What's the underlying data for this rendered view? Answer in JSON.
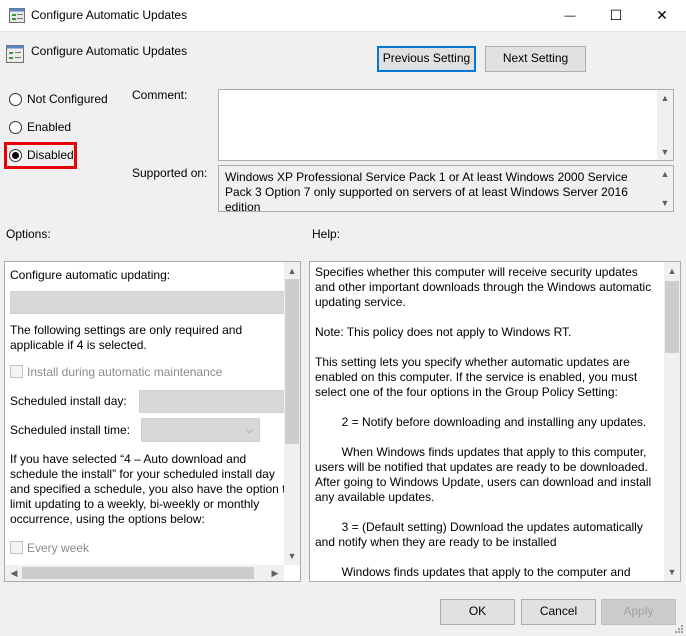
{
  "window": {
    "title": "Configure Automatic Updates",
    "minimize_glyph": "—",
    "maximize_glyph": "☐",
    "close_glyph": "✕"
  },
  "header": {
    "policy_name": "Configure Automatic Updates",
    "prev_button": "Previous Setting",
    "next_button": "Next Setting"
  },
  "state_options": [
    {
      "label": "Not Configured",
      "selected": false
    },
    {
      "label": "Enabled",
      "selected": false
    },
    {
      "label": "Disabled",
      "selected": true
    }
  ],
  "comment": {
    "label": "Comment:",
    "value": ""
  },
  "supported": {
    "label": "Supported on:",
    "text": "Windows XP Professional Service Pack 1 or At least Windows 2000 Service Pack 3 Option 7 only supported on servers of at least Windows Server 2016 edition"
  },
  "options": {
    "label": "Options:",
    "configure_label": "Configure automatic updating:",
    "note": "The following settings are only required and applicable if 4 is selected.",
    "install_maintenance": "Install during automatic maintenance",
    "scheduled_day_label": "Scheduled install day:",
    "scheduled_time_label": "Scheduled install time:",
    "long_note": "If you have selected “4 – Auto download and schedule the install” for your scheduled install day and specified a schedule, you also have the option to limit updating to a weekly, bi-weekly or monthly occurrence, using the options below:",
    "every_week": "Every week"
  },
  "help": {
    "label": "Help:",
    "paragraphs": [
      "Specifies whether this computer will receive security updates and other important downloads through the Windows automatic updating service.",
      "Note: This policy does not apply to Windows RT.",
      "This setting lets you specify whether automatic updates are enabled on this computer. If the service is enabled, you must select one of the four options in the Group Policy Setting:",
      "        2 = Notify before downloading and installing any updates.",
      "        When Windows finds updates that apply to this computer, users will be notified that updates are ready to be downloaded. After going to Windows Update, users can download and install any available updates.",
      "        3 = (Default setting) Download the updates automatically and notify when they are ready to be installed",
      "        Windows finds updates that apply to the computer and downloads them in the background (the user is not notified"
    ]
  },
  "footer": {
    "ok": "OK",
    "cancel": "Cancel",
    "apply": "Apply"
  },
  "colors": {
    "highlight_red": "#e8000b",
    "focus_blue": "#0078d7"
  }
}
